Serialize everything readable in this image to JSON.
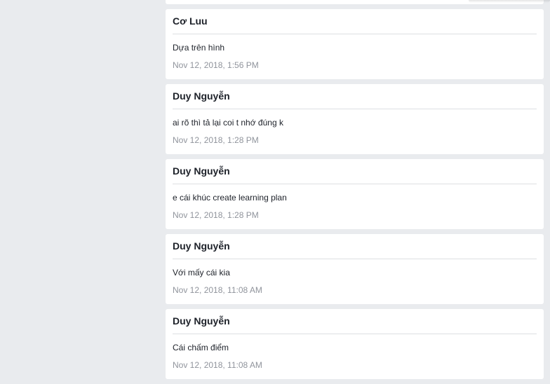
{
  "comments": [
    {
      "author": "Cơ Luu",
      "message": "Dựa trên hình",
      "timestamp": "Nov 12, 2018, 1:56 PM"
    },
    {
      "author": "Duy Nguyễn",
      "message": "ai rõ thì tả lại coi t nhớ đúng k",
      "timestamp": "Nov 12, 2018, 1:28 PM"
    },
    {
      "author": "Duy Nguyễn",
      "message": "e cái khúc create learning plan",
      "timestamp": "Nov 12, 2018, 1:28 PM"
    },
    {
      "author": "Duy Nguyễn",
      "message": "Với mấy cái kia",
      "timestamp": "Nov 12, 2018, 11:08 AM"
    },
    {
      "author": "Duy Nguyễn",
      "message": "Cái chấm điểm",
      "timestamp": "Nov 12, 2018, 11:08 AM"
    }
  ]
}
